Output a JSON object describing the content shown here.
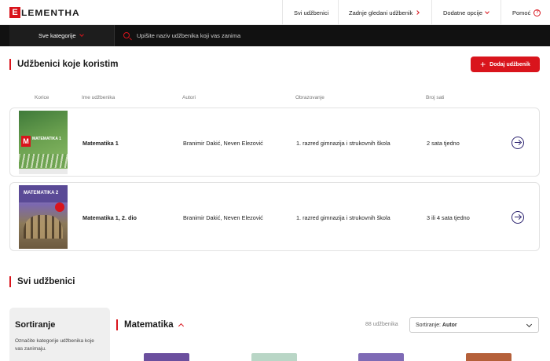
{
  "header": {
    "logo_letter": "E",
    "logo_text": "LEMENTHA",
    "nav": [
      {
        "label": "Svi udžbenici"
      },
      {
        "label": "Zadnje gledani udžbenik"
      },
      {
        "label": "Dodatne opcije"
      },
      {
        "label": "Pomoć"
      }
    ]
  },
  "searchbar": {
    "category_label": "Sve kategorije",
    "placeholder": "Upišite naziv udžbenika koji vas zanima"
  },
  "my_books": {
    "title": "Udžbenici koje koristim",
    "add_button": "Dodaj udžbenik",
    "columns": [
      "Korice",
      "Ime udžbenika",
      "Autori",
      "Obrazovanje",
      "Broj sati"
    ],
    "rows": [
      {
        "title": "Matematika 1",
        "authors": "Branimir Dakić, Neven Elezović",
        "education": "1. razred gimnazija i strukovnih škola",
        "hours": "2 sata tjedno",
        "cover_text": "MATEMATIKA 1",
        "cover_letter": "M"
      },
      {
        "title": "Matematika 1, 2. dio",
        "authors": "Branimir Dakić, Neven Elezović",
        "education": "1. razred gimnazija i strukovnih škola",
        "hours": "3 ili 4 sata tjedno",
        "cover_text": "MATEMATIKA 2"
      }
    ]
  },
  "all_books": {
    "title": "Svi udžbenici",
    "sort_panel": {
      "heading": "Sortiranje",
      "description": "Označite kategorije udžbenika koje vas zanimaju."
    },
    "category_title": "Matematika",
    "count": "88 udžbenika",
    "sort_label": "Sortiranje:",
    "sort_value": "Autor"
  },
  "colors": {
    "accent": "#d9141c",
    "dark": "#111111",
    "arrow": "#2d2470"
  }
}
